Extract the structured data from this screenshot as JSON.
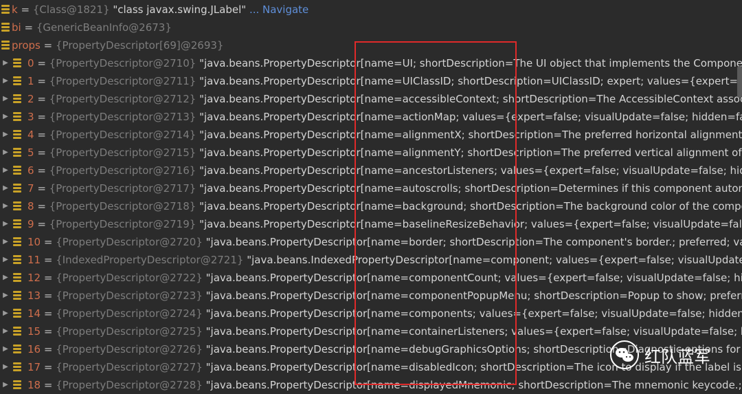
{
  "header_rows": [
    {
      "name": "k",
      "type": "{Class@1821}",
      "value": "\"class javax.swing.JLabel\"",
      "suffix": "... Navigate"
    },
    {
      "name": "bi",
      "type": "{GenericBeanInfo@2673}",
      "value": "",
      "suffix": ""
    },
    {
      "name": "props",
      "type": "{PropertyDescriptor[69]@2693}",
      "value": "",
      "suffix": ""
    }
  ],
  "rows": [
    {
      "index": "0",
      "type": "{PropertyDescriptor@2710}",
      "value": "\"java.beans.PropertyDescriptor[name=UI; shortDescription=The UI object that implements the Component's"
    },
    {
      "index": "1",
      "type": "{PropertyDescriptor@2711}",
      "value": "\"java.beans.PropertyDescriptor[name=UIClassID; shortDescription=UIClassID; expert; values={expert=false; vi"
    },
    {
      "index": "2",
      "type": "{PropertyDescriptor@2712}",
      "value": "\"java.beans.PropertyDescriptor[name=accessibleContext; shortDescription=The AccessibleContext associate"
    },
    {
      "index": "3",
      "type": "{PropertyDescriptor@2713}",
      "value": "\"java.beans.PropertyDescriptor[name=actionMap; values={expert=false; visualUpdate=false; hidden=false; e"
    },
    {
      "index": "4",
      "type": "{PropertyDescriptor@2714}",
      "value": "\"java.beans.PropertyDescriptor[name=alignmentX; shortDescription=The preferred horizontal alignment of t"
    },
    {
      "index": "5",
      "type": "{PropertyDescriptor@2715}",
      "value": "\"java.beans.PropertyDescriptor[name=alignmentY; shortDescription=The preferred vertical alignment of the"
    },
    {
      "index": "6",
      "type": "{PropertyDescriptor@2716}",
      "value": "\"java.beans.PropertyDescriptor[name=ancestorListeners; values={expert=false; visualUpdate=false; hidden="
    },
    {
      "index": "7",
      "type": "{PropertyDescriptor@2717}",
      "value": "\"java.beans.PropertyDescriptor[name=autoscrolls; shortDescription=Determines if this component automati"
    },
    {
      "index": "8",
      "type": "{PropertyDescriptor@2718}",
      "value": "\"java.beans.PropertyDescriptor[name=background; shortDescription=The background color of the compone"
    },
    {
      "index": "9",
      "type": "{PropertyDescriptor@2719}",
      "value": "\"java.beans.PropertyDescriptor[name=baselineResizeBehavior; values={expert=false; visualUpdate=false; hid"
    },
    {
      "index": "10",
      "type": "{PropertyDescriptor@2720}",
      "value": "\"java.beans.PropertyDescriptor[name=border; shortDescription=The component's border.; preferred; value"
    },
    {
      "index": "11",
      "type": "{IndexedPropertyDescriptor@2721}",
      "value": "\"java.beans.IndexedPropertyDescriptor[name=component; values={expert=false; visualUpdate=fals"
    },
    {
      "index": "12",
      "type": "{PropertyDescriptor@2722}",
      "value": "\"java.beans.PropertyDescriptor[name=componentCount; values={expert=false; visualUpdate=false; hidden"
    },
    {
      "index": "13",
      "type": "{PropertyDescriptor@2723}",
      "value": "\"java.beans.PropertyDescriptor[name=componentPopupMenu; shortDescription=Popup to show; preferred"
    },
    {
      "index": "14",
      "type": "{PropertyDescriptor@2724}",
      "value": "\"java.beans.PropertyDescriptor[name=components; values={expert=false; visualUpdate=false; hidden=fals"
    },
    {
      "index": "15",
      "type": "{PropertyDescriptor@2725}",
      "value": "\"java.beans.PropertyDescriptor[name=containerListeners; values={expert=false; visualUpdate=false; hidder"
    },
    {
      "index": "16",
      "type": "{PropertyDescriptor@2726}",
      "value": "\"java.beans.PropertyDescriptor[name=debugGraphicsOptions; shortDescription=Diagnostic options for gra"
    },
    {
      "index": "17",
      "type": "{PropertyDescriptor@2727}",
      "value": "\"java.beans.PropertyDescriptor[name=disabledIcon; shortDescription=The icon to display if the label is disa"
    },
    {
      "index": "18",
      "type": "{PropertyDescriptor@2728}",
      "value": "\"java.beans.PropertyDescriptor[name=displayedMnemonic; shortDescription=The mnemonic keycode.; pre"
    }
  ],
  "watermark": {
    "text": "红队蓝军",
    "icon": "wechat-icon"
  },
  "colors": {
    "highlight": "#e02a2a",
    "name": "#cf6e4c",
    "type": "#7d7d7d",
    "link": "#5f8fd9",
    "field_icon": "#c9a227"
  }
}
